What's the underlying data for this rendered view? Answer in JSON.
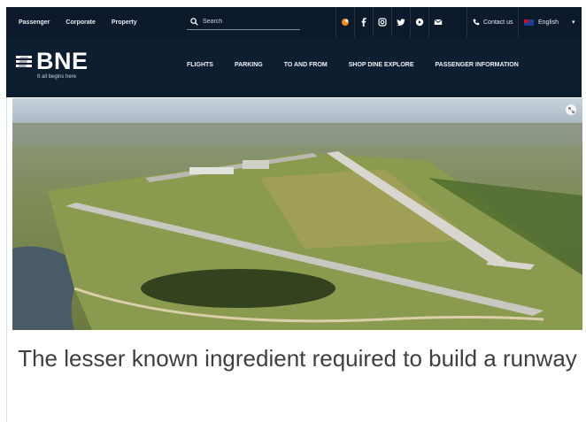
{
  "topbar": {
    "audience_links": [
      "Passenger",
      "Corporate",
      "Property"
    ],
    "search_placeholder": "Search",
    "social_icons": [
      "shuffle-icon",
      "facebook-icon",
      "instagram-icon",
      "twitter-icon",
      "youtube-icon",
      "email-icon"
    ],
    "contact_label": "Contact us",
    "language_label": "English"
  },
  "nav": {
    "logo_text": "BNE",
    "tagline": "It all begins here",
    "links": [
      "FLIGHTS",
      "PARKING",
      "TO AND FROM",
      "SHOP DINE EXPLORE",
      "PASSENGER INFORMATION"
    ]
  },
  "hero": {
    "image_subject": "aerial view of airport runway"
  },
  "article": {
    "headline": "The lesser known ingredient required to build a runway"
  },
  "colors": {
    "header_bg": "#0c1a2b",
    "nav_bg": "#0e1e31",
    "headline_text": "#3f3f3f"
  }
}
